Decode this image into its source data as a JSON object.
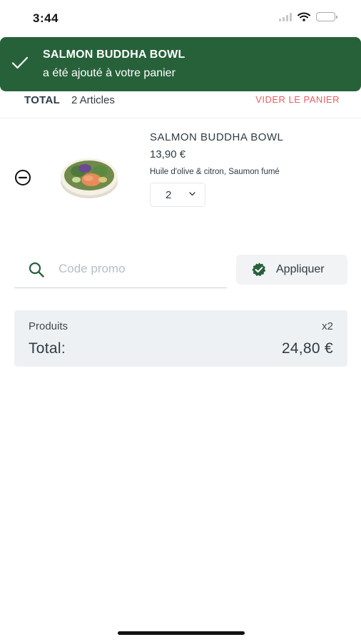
{
  "status_bar": {
    "time": "3:44",
    "icons": [
      "signal-icon",
      "wifi-icon",
      "battery-icon"
    ]
  },
  "toast": {
    "icon": "check-icon",
    "title": "SALMON BUDDHA BOWL",
    "message": "a été ajouté à votre panier",
    "background": "#27613a"
  },
  "cart_header": {
    "total_label": "TOTAL",
    "articles_count": "2 Articles",
    "clear_label": "VIDER LE PANIER",
    "clear_color": "#e85d64"
  },
  "cart_items": [
    {
      "name": "SALMON BUDDHA BOWL",
      "price": "13,90 €",
      "options": "Huile d'olive & citron, Saumon fumé",
      "quantity": "2",
      "image": "salmon-buddha-bowl-photo",
      "remove_icon": "minus-circle-icon"
    }
  ],
  "promo": {
    "icon": "search-icon",
    "placeholder": "Code promo",
    "value": "",
    "apply_label": "Appliquer",
    "apply_icon": "badge-check-icon"
  },
  "summary": {
    "products_label": "Produits",
    "products_quantity": "x2",
    "total_label": "Total:",
    "total_amount": "24,80 €"
  },
  "colors": {
    "brand_green": "#27613a",
    "accent_red": "#e85d64",
    "text": "#2f3b45"
  }
}
